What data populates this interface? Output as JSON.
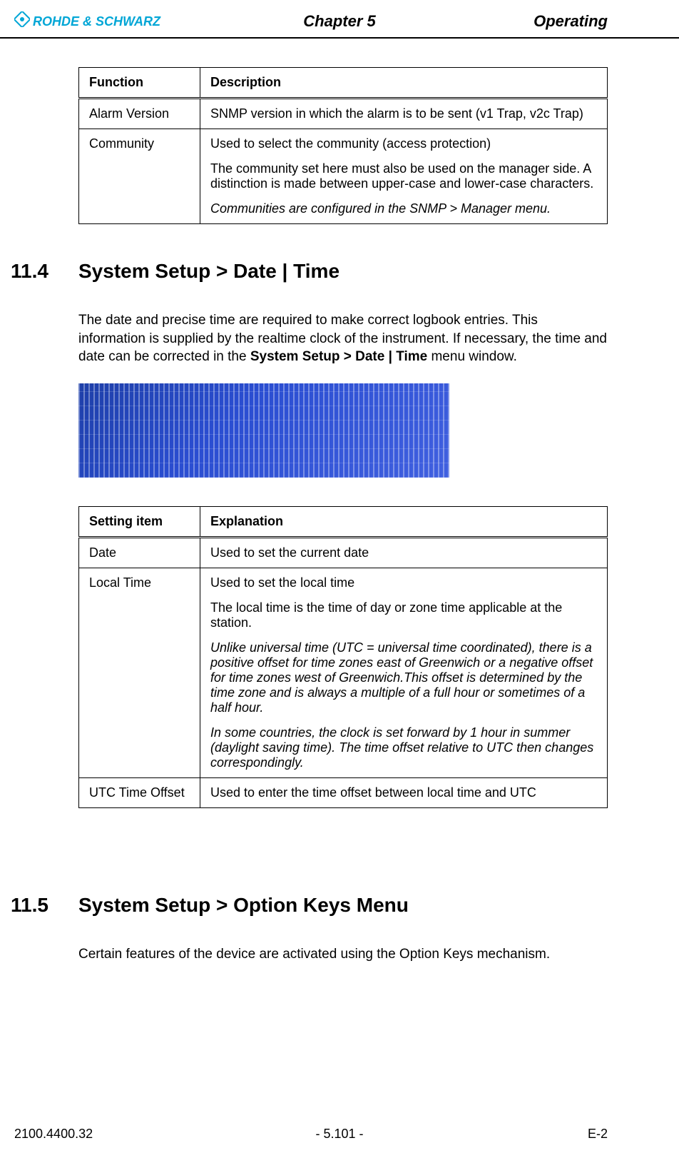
{
  "header": {
    "logo_text": "ROHDE & SCHWARZ",
    "center": "Chapter 5",
    "right": "Operating"
  },
  "table_functions": {
    "head": {
      "col1": "Function",
      "col2": "Description"
    },
    "rows": [
      {
        "col1": "Alarm Version",
        "col2": "SNMP version in which the alarm is to be sent (v1 Trap, v2c Trap)"
      },
      {
        "col1": "Community",
        "col2_p1": "Used to select the community (access protection)",
        "col2_p2": "The community set here must also be used on the manager side. A distinction is made between upper-case and lower-case characters.",
        "col2_p3": "Communities are configured in the SNMP > Manager menu."
      }
    ]
  },
  "section_114": {
    "number": "11.4",
    "title": "System Setup > Date | Time",
    "body_pre": "The date and precise time are required to make correct logbook entries. This information is supplied by the realtime clock of the instrument. If necessary, the time and date can be corrected in the ",
    "body_bold": "System Setup > Date | Time",
    "body_post": " menu window."
  },
  "table_settings": {
    "head": {
      "col1": "Setting item",
      "col2": "Explanation"
    },
    "rows": [
      {
        "col1": "Date",
        "col2": "Used to set the current date"
      },
      {
        "col1": "Local Time",
        "p1": "Used to set the local time",
        "p2": "The local time is the time of day or zone time applicable at the station.",
        "p3": "Unlike universal time (UTC = universal time coordinated), there is a positive offset for time zones east of Greenwich or a negative offset for time zones west of Greenwich.This offset is determined by the time zone and is always a multiple of a full hour or sometimes of a half hour.",
        "p4": "In some countries, the clock is set forward by 1 hour in summer (daylight saving time). The time offset relative to UTC then changes correspondingly."
      },
      {
        "col1": "UTC Time Offset",
        "col2": "Used to enter the time offset between local time and UTC"
      }
    ]
  },
  "section_115": {
    "number": "11.5",
    "title": "System Setup > Option Keys Menu",
    "body": "Certain features of the device are activated using the Option Keys mechanism."
  },
  "footer": {
    "left": "2100.4400.32",
    "center": "- 5.101 -",
    "right": "E-2"
  }
}
